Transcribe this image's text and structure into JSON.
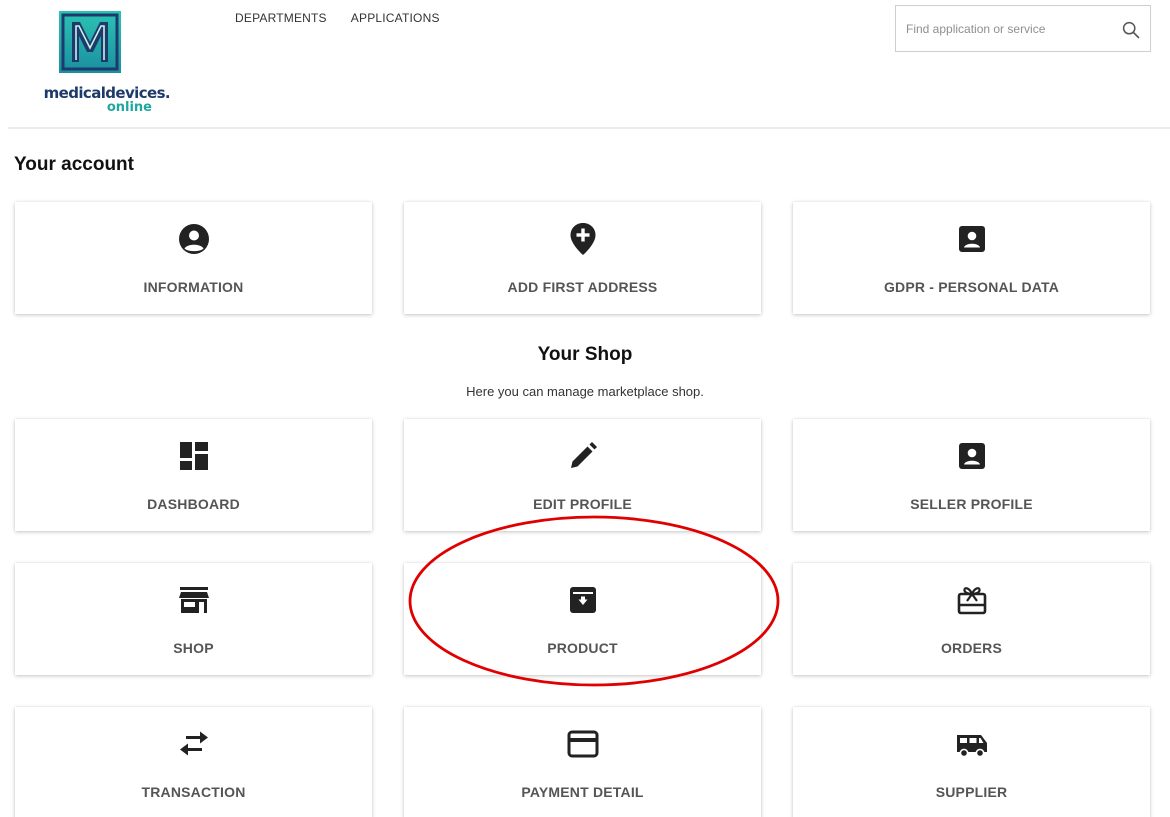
{
  "header": {
    "logo": {
      "letter": "M",
      "line1": "medicaldevices.",
      "line2": "online"
    },
    "nav": [
      {
        "label": "DEPARTMENTS"
      },
      {
        "label": "APPLICATIONS"
      }
    ],
    "search": {
      "placeholder": "Find application or service",
      "value": ""
    }
  },
  "account": {
    "title": "Your account",
    "cards": [
      {
        "label": "INFORMATION",
        "icon": "user-circle-icon"
      },
      {
        "label": "ADD FIRST ADDRESS",
        "icon": "map-marker-plus-icon"
      },
      {
        "label": "GDPR - PERSONAL DATA",
        "icon": "contact-card-icon"
      }
    ]
  },
  "shop": {
    "title": "Your Shop",
    "subtitle": "Here you can manage marketplace shop.",
    "cards": [
      {
        "label": "DASHBOARD",
        "icon": "dashboard-icon"
      },
      {
        "label": "EDIT PROFILE",
        "icon": "pencil-icon"
      },
      {
        "label": "SELLER PROFILE",
        "icon": "contact-card-icon"
      },
      {
        "label": "SHOP",
        "icon": "storefront-icon"
      },
      {
        "label": "PRODUCT",
        "icon": "archive-box-icon"
      },
      {
        "label": "ORDERS",
        "icon": "gift-card-icon"
      },
      {
        "label": "TRANSACTION",
        "icon": "swap-arrows-icon"
      },
      {
        "label": "PAYMENT DETAIL",
        "icon": "credit-card-icon"
      },
      {
        "label": "SUPPLIER",
        "icon": "van-icon"
      }
    ]
  },
  "colors": {
    "logo_teal": "#20a7a0",
    "logo_navy": "#1d3a6b",
    "icon": "#222222",
    "label": "#555555",
    "annotation": "#e00000"
  }
}
